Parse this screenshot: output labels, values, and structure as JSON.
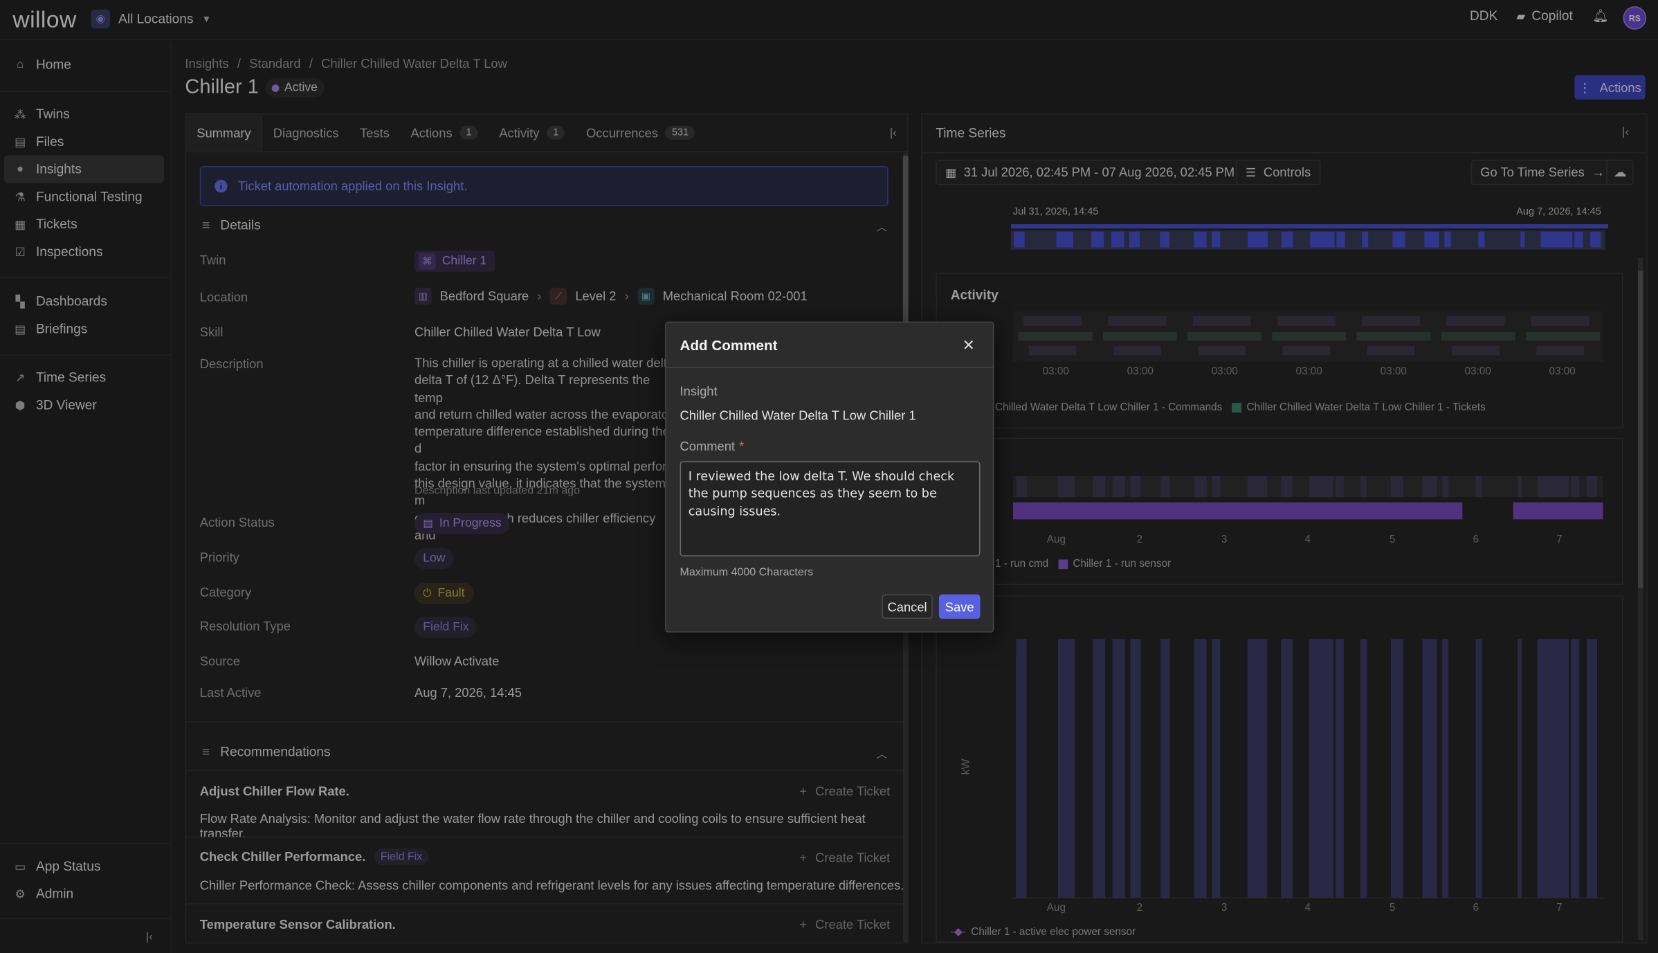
{
  "app": {
    "logo": "willow",
    "location_label": "All Locations",
    "site_code": "DDK",
    "copilot": "Copilot",
    "avatar_initials": "RS"
  },
  "sidebar": {
    "items": [
      {
        "label": "Home",
        "icon": "home-icon"
      },
      {
        "label": "Twins",
        "icon": "twins-icon"
      },
      {
        "label": "Files",
        "icon": "file-icon"
      },
      {
        "label": "Insights",
        "icon": "lightbulb-icon"
      },
      {
        "label": "Functional Testing",
        "icon": "test-icon"
      },
      {
        "label": "Tickets",
        "icon": "ticket-icon"
      },
      {
        "label": "Inspections",
        "icon": "checkbox-icon"
      },
      {
        "label": "Dashboards",
        "icon": "dashboard-icon"
      },
      {
        "label": "Briefings",
        "icon": "briefing-icon"
      },
      {
        "label": "Time Series",
        "icon": "chart-line-icon"
      },
      {
        "label": "3D Viewer",
        "icon": "cube-icon"
      },
      {
        "label": "App Status",
        "icon": "status-icon"
      },
      {
        "label": "Admin",
        "icon": "gear-icon"
      }
    ]
  },
  "breadcrumb": {
    "items": [
      "Insights",
      "Standard",
      "Chiller Chilled Water Delta T Low"
    ],
    "separator": "/"
  },
  "header": {
    "title": "Chiller 1",
    "status": "Active",
    "actions_label": "Actions"
  },
  "tabs": [
    {
      "label": "Summary",
      "count": ""
    },
    {
      "label": "Diagnostics",
      "count": ""
    },
    {
      "label": "Tests",
      "count": ""
    },
    {
      "label": "Actions",
      "count": "1"
    },
    {
      "label": "Activity",
      "count": "1"
    },
    {
      "label": "Occurrences",
      "count": "531"
    }
  ],
  "notice": "Ticket automation applied on this Insight.",
  "details": {
    "heading": "Details",
    "twin_label": "Twin",
    "twin_value": "Chiller 1",
    "location_label": "Location",
    "location": [
      "Bedford Square",
      "Level 2",
      "Mechanical Room 02-001"
    ],
    "skill_label": "Skill",
    "skill_value": "Chiller Chilled Water Delta T Low",
    "description_label": "Description",
    "description": "This chiller is operating at a chilled water delta\ndelta T of (12 Δ°F). Delta T represents the temp\nand return chilled water across the evaporator.\ntemperature difference established during the d\nfactor in ensuring the system's optimal perform\nthis design value, it indicates that the system m\nevaporator, which reduces chiller efficiency and",
    "description_updated": "Description last updated 21m ago",
    "action_status_label": "Action Status",
    "action_status": "In Progress",
    "priority_label": "Priority",
    "priority": "Low",
    "category_label": "Category",
    "category": "Fault",
    "resolution_label": "Resolution Type",
    "resolution": "Field Fix",
    "source_label": "Source",
    "source": "Willow Activate",
    "last_active_label": "Last Active",
    "last_active": "Aug 7, 2026, 14:45"
  },
  "recommendations": {
    "heading": "Recommendations",
    "create_ticket": "Create Ticket",
    "items": [
      {
        "title": "Adjust Chiller Flow Rate.",
        "badge": "",
        "text": "Flow Rate Analysis: Monitor and adjust the water flow rate through the chiller and cooling coils to ensure sufficient heat transfer."
      },
      {
        "title": "Check Chiller Performance.",
        "badge": "Field Fix",
        "text": "Chiller Performance Check: Assess chiller components and refrigerant levels for any issues affecting temperature differences."
      },
      {
        "title": "Temperature Sensor Calibration.",
        "badge": "",
        "text": ""
      }
    ]
  },
  "timeseries": {
    "title": "Time Series",
    "date_range": "31 Jul 2026, 02:45 PM - 07 Aug 2026, 02:45 PM",
    "controls": "Controls",
    "goto": "Go To Time Series",
    "range_start": "Jul 31, 2026, 14:45",
    "range_end": "Aug 7, 2026, 14:45",
    "activity_title": "Activity",
    "activity_ticks": [
      "03:00",
      "03:00",
      "03:00",
      "03:00",
      "03:00",
      "03:00",
      "03:00"
    ],
    "legend1": [
      "Chilled Water Delta T Low Chiller 1 - Commands",
      "Chiller Chilled Water Delta T Low Chiller 1 - Tickets"
    ],
    "legend2": [
      "1 - run cmd",
      "Chiller 1 - run sensor"
    ],
    "legend3": [
      "Chiller 1 - active elec power sensor"
    ],
    "day_ticks": [
      "Aug",
      "2",
      "3",
      "4",
      "5",
      "6",
      "7"
    ],
    "ylabel3": "kW"
  },
  "modal": {
    "title": "Add Comment",
    "insight_label": "Insight",
    "insight_value": "Chiller Chilled Water Delta T Low Chiller 1",
    "comment_label": "Comment",
    "required_mark": "*",
    "comment_value": "I reviewed the low delta T. We should check the pump sequences as they seem to be causing issues.",
    "hint": "Maximum 4000 Characters",
    "cancel": "Cancel",
    "save": "Save"
  },
  "colors": {
    "accent": "#5a61e0",
    "purple": "#a78bfa",
    "bg": "#242424"
  }
}
